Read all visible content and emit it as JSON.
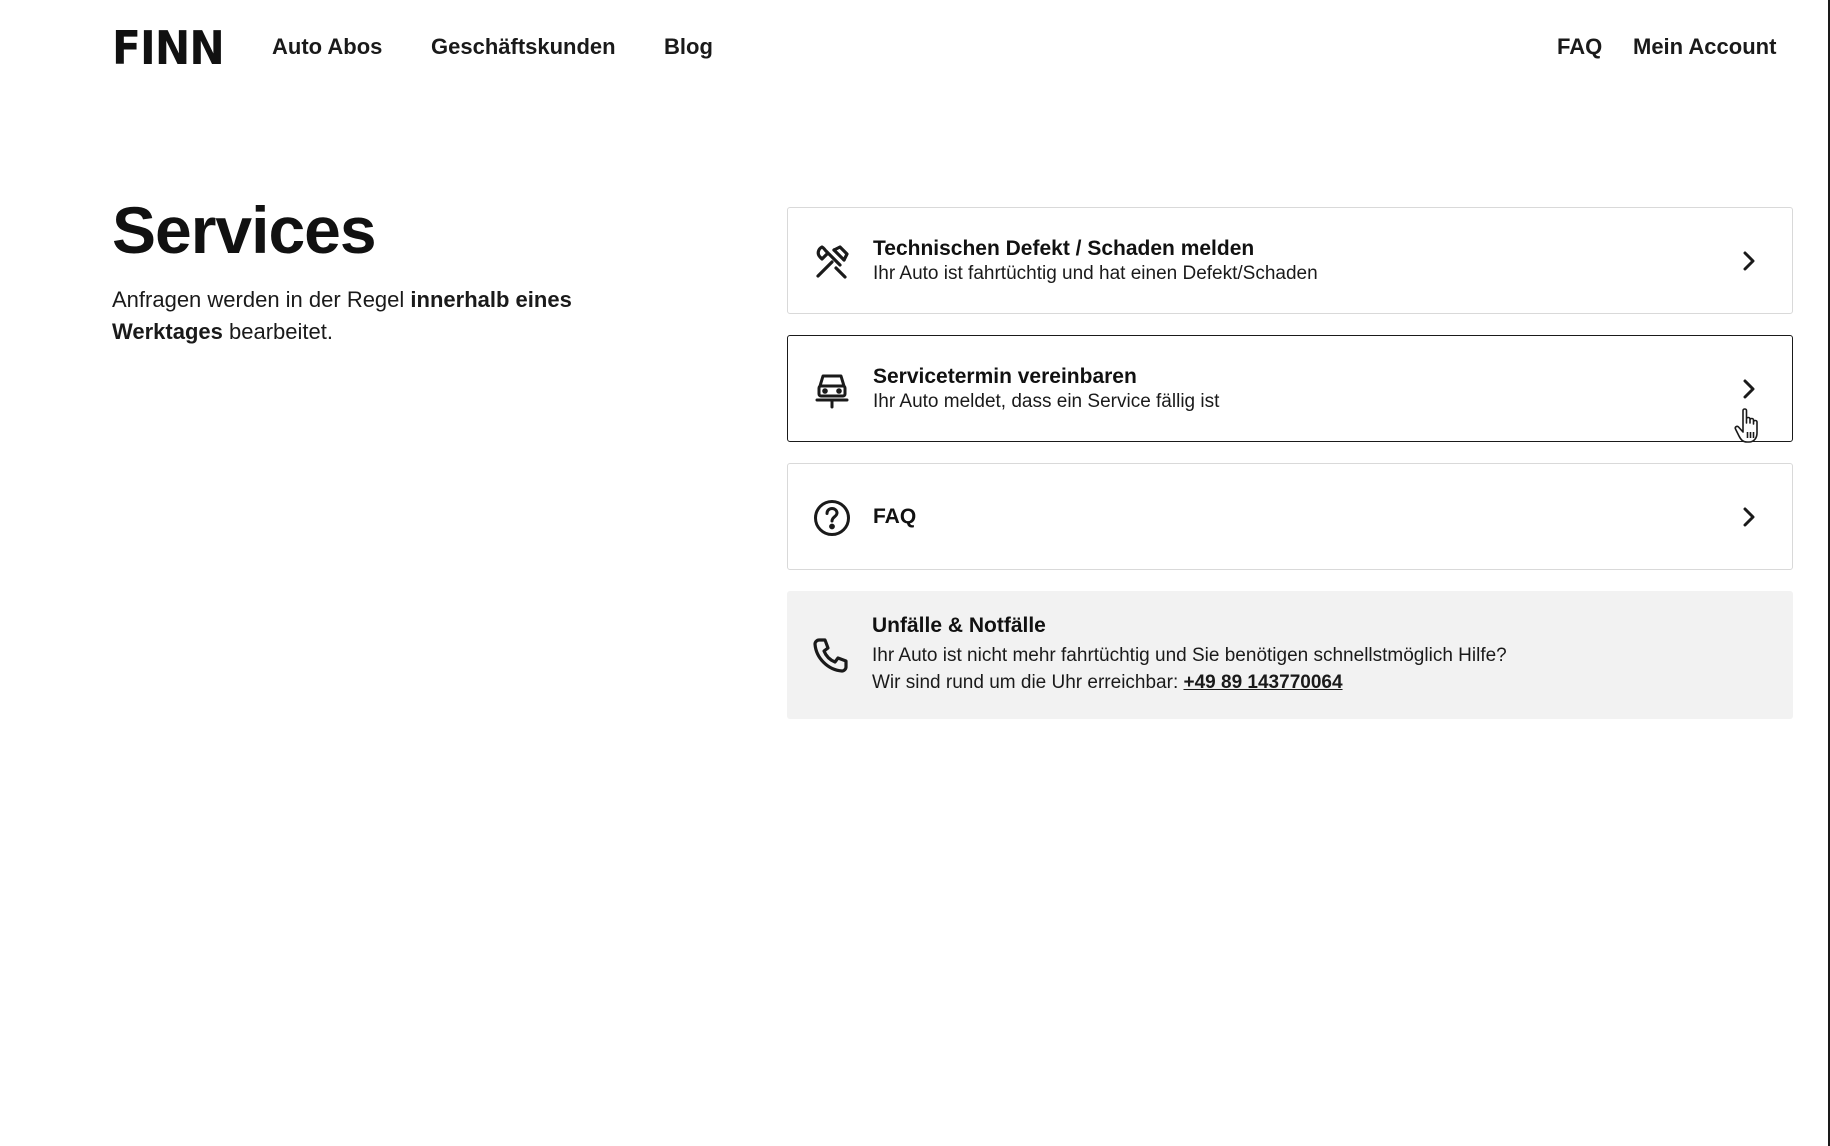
{
  "header": {
    "logo": "FINN",
    "nav": {
      "auto_abos": "Auto Abos",
      "geschaeftskunden": "Geschäftskunden",
      "blog": "Blog"
    },
    "right": {
      "faq": "FAQ",
      "account": "Mein Account"
    }
  },
  "main": {
    "title": "Services",
    "intro": {
      "part1": "Anfragen werden in der Regel ",
      "bold": "innerhalb eines Werktages",
      "part2": " bearbeitet."
    }
  },
  "cards": [
    {
      "icon": "tools-icon",
      "title": "Technischen Defekt / Schaden melden",
      "subtitle": "Ihr Auto ist fahrtüchtig und hat einen Defekt/Schaden"
    },
    {
      "icon": "car-service-icon",
      "title": "Servicetermin vereinbaren",
      "subtitle": "Ihr Auto meldet, dass ein Service fällig ist"
    },
    {
      "icon": "question-circle-icon",
      "title": "FAQ"
    }
  ],
  "emergency": {
    "icon": "phone-icon",
    "title": "Unfälle & Notfälle",
    "line1": "Ihr Auto ist nicht mehr fahrtüchtig und Sie benötigen schnellstmöglich Hilfe?",
    "line2_prefix": "Wir sind rund um die Uhr erreichbar: ",
    "phone": "+49 89 143770064"
  },
  "colors": {
    "text": "#1a1a1a",
    "border": "#d9d9d9",
    "hover_border": "#1a1a1a",
    "emergency_bg": "#f2f2f2"
  }
}
